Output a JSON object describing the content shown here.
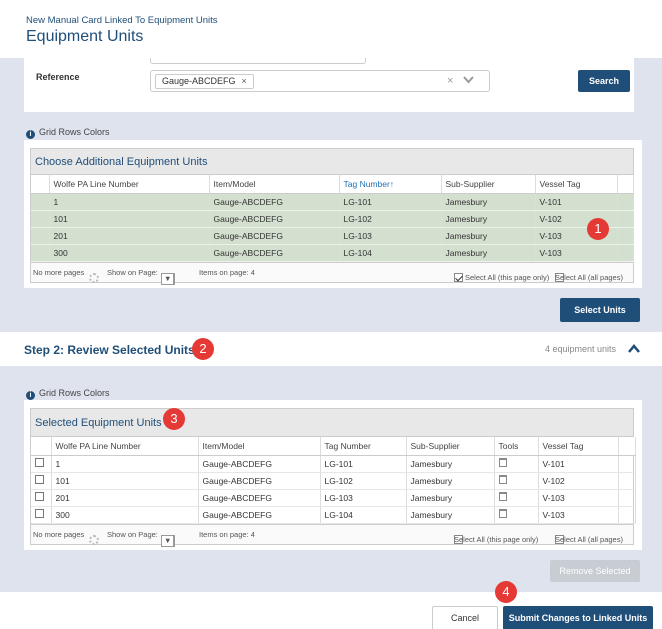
{
  "header": {
    "breadcrumb": "New Manual Card Linked To Equipment Units",
    "title": "Equipment Units"
  },
  "filter": {
    "reference_label": "Reference",
    "reference_value": "Gauge-ABCDEFG",
    "chip_remove": "×",
    "clear_icon": "×",
    "dropdown_icon": "chevron-down-icon",
    "search_label": "Search"
  },
  "grid_rows_colors": "Grid Rows Colors",
  "info_icon_glyph": "i",
  "additional_grid": {
    "title": "Choose Additional Equipment Units",
    "columns": [
      "Wolfe PA Line Number",
      "Item/Model",
      "Tag Number↑",
      "Sub-Supplier",
      "Vessel Tag"
    ],
    "rows": [
      [
        "1",
        "Gauge-ABCDEFG",
        "LG-101",
        "Jamesbury",
        "V-101"
      ],
      [
        "101",
        "Gauge-ABCDEFG",
        "LG-102",
        "Jamesbury",
        "V-102"
      ],
      [
        "201",
        "Gauge-ABCDEFG",
        "LG-103",
        "Jamesbury",
        "V-103"
      ],
      [
        "300",
        "Gauge-ABCDEFG",
        "LG-104",
        "Jamesbury",
        "V-103"
      ]
    ],
    "row_color": "#d3dfcf",
    "footer": {
      "pages": "No more pages",
      "show_on_page": "Show on Page:",
      "page_size": "20",
      "items": "Items on page: 4",
      "select_all_page": "Select All (this page only)",
      "select_all_pages": "Select All (all pages)"
    }
  },
  "select_units_label": "Select Units",
  "step2": {
    "title": "Step 2: Review Selected Units",
    "count": "4 equipment units",
    "chevron": "^"
  },
  "selected_grid": {
    "title": "Selected Equipment Units",
    "columns": [
      "Wolfe PA Line Number",
      "Item/Model",
      "Tag Number",
      "Sub-Supplier",
      "Tools",
      "Vessel Tag"
    ],
    "rows": [
      [
        "1",
        "Gauge-ABCDEFG",
        "LG-101",
        "Jamesbury",
        "V-101"
      ],
      [
        "101",
        "Gauge-ABCDEFG",
        "LG-102",
        "Jamesbury",
        "V-102"
      ],
      [
        "201",
        "Gauge-ABCDEFG",
        "LG-103",
        "Jamesbury",
        "V-103"
      ],
      [
        "300",
        "Gauge-ABCDEFG",
        "LG-104",
        "Jamesbury",
        "V-103"
      ]
    ],
    "footer": {
      "pages": "No more pages",
      "show_on_page": "Show on Page:",
      "page_size": "20",
      "items": "Items on page: 4",
      "select_all_page": "Select All (this page only)",
      "select_all_pages": "Select All (all pages)"
    }
  },
  "remove_selected_label": "Remove Selected",
  "cancel_label": "Cancel",
  "submit_label": "Submit Changes to Linked Units",
  "markers": [
    "1",
    "2",
    "3",
    "4"
  ],
  "colors": {
    "brand": "#1f4e79",
    "band": "#dfe3ee",
    "marker": "#e53935"
  }
}
